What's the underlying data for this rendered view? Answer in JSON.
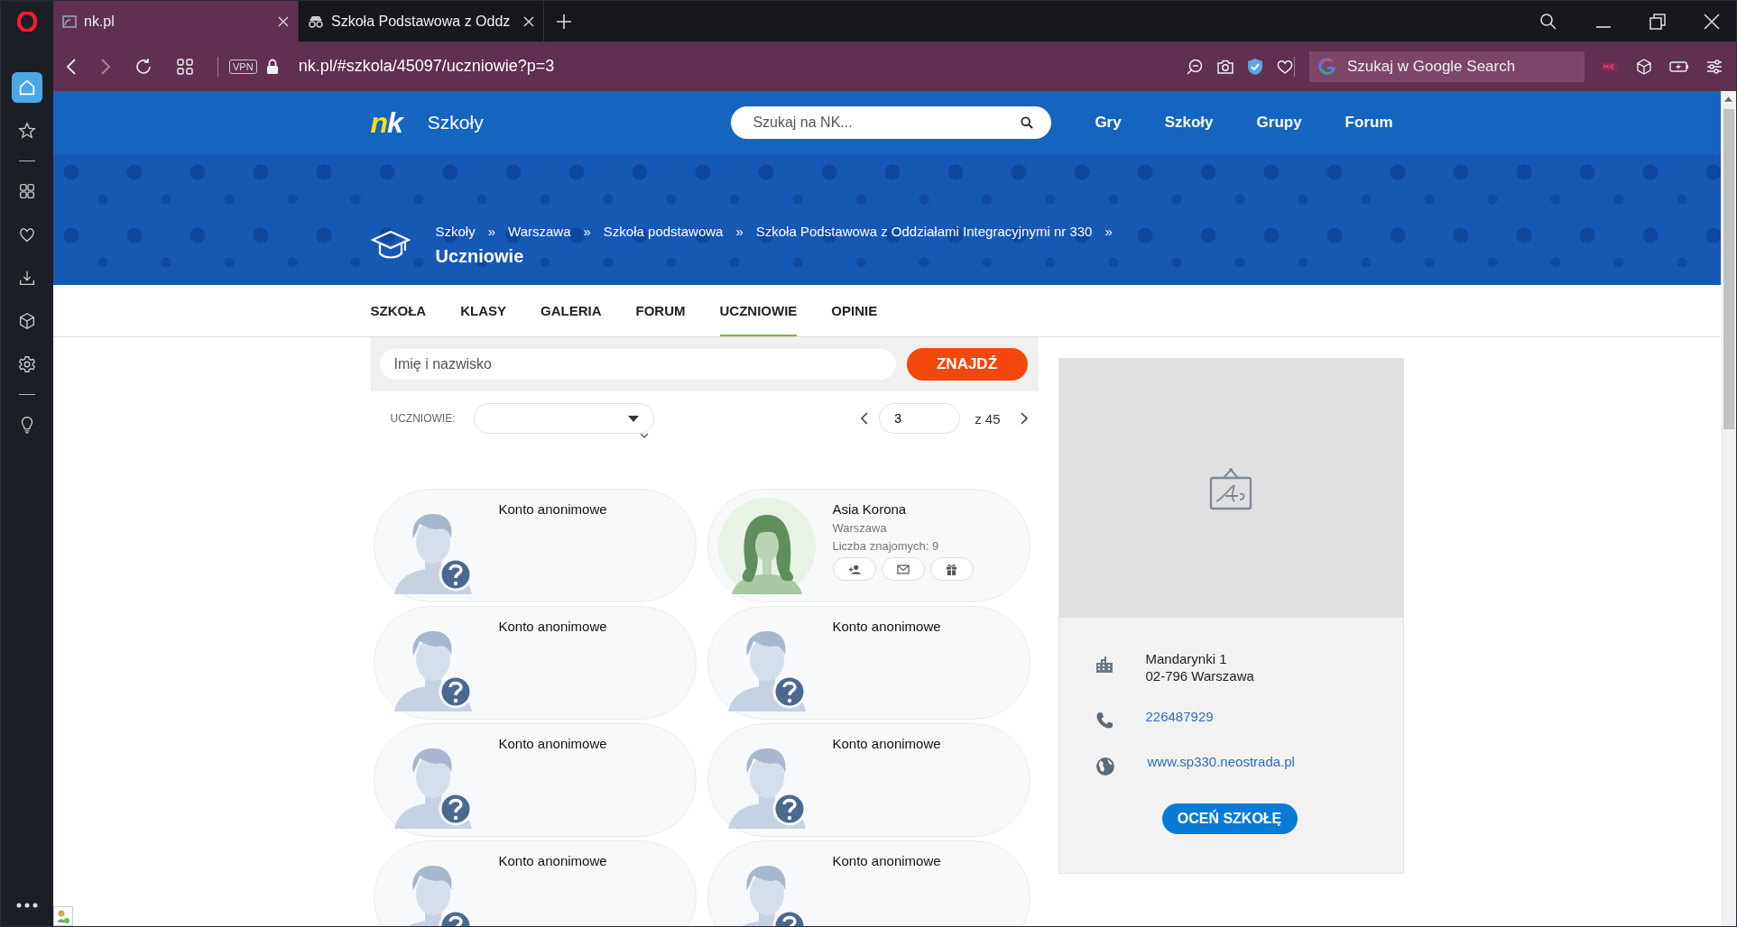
{
  "browser": {
    "tabs": [
      {
        "title": "nk.pl",
        "kind": "site",
        "selected": true
      },
      {
        "title": "Szkoła Podstawowa z Oddz",
        "kind": "private",
        "selected": false
      }
    ],
    "vpn": "VPN",
    "url": "nk.pl/#szkola/45097/uczniowie?p=3",
    "search_placeholder": "Szukaj w Google Search",
    "sidebar_items": [
      {
        "kind": "home",
        "selected": true
      },
      {
        "kind": "star",
        "selected": false
      },
      {
        "kind": "divider"
      },
      {
        "kind": "grid",
        "selected": false
      },
      {
        "kind": "heart",
        "selected": false
      },
      {
        "kind": "download",
        "selected": false
      },
      {
        "kind": "cube",
        "selected": false
      },
      {
        "kind": "gear",
        "selected": false
      },
      {
        "kind": "divider"
      },
      {
        "kind": "bulb",
        "selected": false
      }
    ]
  },
  "site": {
    "logo_letters": [
      "n",
      "k"
    ],
    "section": "Szkoły",
    "search_placeholder": "Szukaj na NK...",
    "nav": [
      "Gry",
      "Szkoły",
      "Grupy",
      "Forum"
    ],
    "breadcrumbs": [
      "Szkoły",
      "Warszawa",
      "Szkoła podstawowa",
      "Szkoła Podstawowa z Oddziałami Integracyjnymi nr 330"
    ],
    "separator": "»",
    "title": "Uczniowie",
    "tabs": [
      {
        "label": "SZKOŁA",
        "selected": false
      },
      {
        "label": "KLASY",
        "selected": false
      },
      {
        "label": "GALERIA",
        "selected": false
      },
      {
        "label": "FORUM",
        "selected": false
      },
      {
        "label": "UCZNIOWIE",
        "selected": true
      },
      {
        "label": "OPINIE",
        "selected": false
      }
    ],
    "name_search": {
      "placeholder": "Imię i nazwisko",
      "button": "ZNAJDŹ"
    },
    "filter": {
      "label": "UCZNIOWIE:"
    },
    "pagination": {
      "page": "3",
      "total": "z 45"
    },
    "students": [
      {
        "kind": "anonymous",
        "name": "Konto anonimowe"
      },
      {
        "kind": "profile",
        "name": "Asia Korona",
        "city": "Warszawa",
        "friends": "Liczba znajomych: 9"
      },
      {
        "kind": "anonymous",
        "name": "Konto anonimowe"
      },
      {
        "kind": "anonymous",
        "name": "Konto anonimowe"
      },
      {
        "kind": "anonymous",
        "name": "Konto anonimowe"
      },
      {
        "kind": "anonymous",
        "name": "Konto anonimowe"
      },
      {
        "kind": "anonymous",
        "name": "Konto anonimowe"
      },
      {
        "kind": "anonymous",
        "name": "Konto anonimowe"
      }
    ],
    "school": {
      "address": [
        "Mandarynki 1",
        "02-796 Warszawa"
      ],
      "phone": "226487929",
      "website": "www.sp330.neostrada.pl",
      "rate_button": "OCEŃ SZKOŁĘ"
    }
  }
}
